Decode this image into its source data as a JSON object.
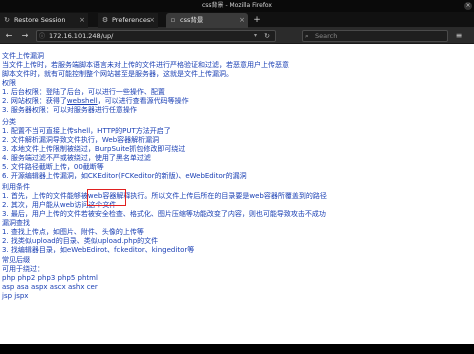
{
  "window": {
    "title": "css背景 - Mozilla Firefox"
  },
  "tabs": [
    {
      "label": "Restore Session",
      "icon": "restore-icon"
    },
    {
      "label": "Preferences",
      "icon": "gear-icon"
    },
    {
      "label": "css背景",
      "icon": "page-icon"
    }
  ],
  "toolbar": {
    "url": "172.16.101.248/up/",
    "search_placeholder": "Search"
  },
  "content": {
    "lines": [
      "文件上传漏洞",
      "当文件上传时，若服务端脚本语言未对上传的文件进行严格验证和过滤，若恶意用户上传恶意",
      "脚本文件时，就有可能控制整个网站甚至是服务器，这就是文件上传漏洞。",
      "权限",
      "1. 后台权限：登陆了后台，可以进行一些操作、配置",
      "2. 网站权限：获得了",
      "3. 服务器权限：可以对服务器进行任意操作",
      "分类",
      "1. 配置不当可直接上传shell，HTTP的PUT方法开启了",
      "2. 文件解析漏洞导致文件执行，Web容器解析漏洞",
      "3. 本地文件上传限制被绕过，BurpSuite抓包修改即可绕过",
      "4. 服务端过滤不严或被绕过，使用了黑名单过滤",
      "5. 文件路径截断上传，00截断等",
      "6. 开源编辑器上传漏洞，如CKEditor(FCKeditor的新版)、eWebEditor的漏洞",
      "利用条件",
      "1. 首先，上传的文件能够被web容器解释执行。所以文件上传后所在的目录要是web容器所覆盖到的路径",
      "2. 其次，用户能从web访问这个文件",
      "3. 最后，用户上传的文件若被安全检查、格式化、图片压缩等功能改变了内容，则也可能导致攻击不成功",
      "漏洞查找",
      "1. 查找上传点，如图片、附件、头像的上传等",
      "2. 找类似upload的目录、类似upload.php的文件",
      "3. 找编辑器目录，如eWebEdirot、fckeditor、kingeditor等",
      "常见后缀",
      "可用于绕过：",
      "php php2 php3 php5 phtml",
      "asp asa aspx ascx ashx cer",
      "jsp jspx"
    ],
    "webshell_link": "webshell",
    "webshell_suffix": "，可以进行查看源代码等操作"
  }
}
